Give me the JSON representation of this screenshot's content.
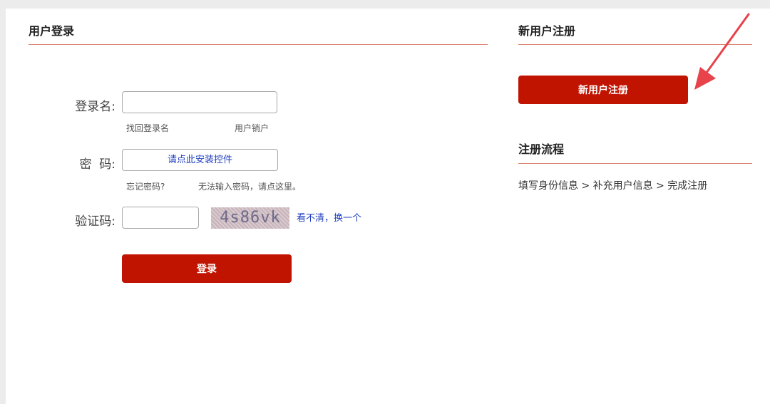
{
  "login": {
    "title": "用户登录",
    "username_label": "登录名:",
    "forgot_username": "找回登录名",
    "deregister": "用户销户",
    "password_label": "密  码:",
    "password_control": "请点此安装控件",
    "forgot_password": "忘记密码?",
    "cannot_input_password": "无法输入密码，请点这里。",
    "captcha_label": "验证码:",
    "captcha_text": "4s86vk",
    "captcha_refresh": "看不清，换一个",
    "login_button": "登录",
    "username_value": "",
    "captcha_value": ""
  },
  "register": {
    "title": "新用户注册",
    "button": "新用户注册"
  },
  "flow": {
    "title": "注册流程",
    "steps": "填写身份信息 > 补充用户信息 > 完成注册"
  },
  "colors": {
    "accent": "#c01300",
    "rule": "#d9826f",
    "link": "#1f3fbf",
    "annotation_arrow": "#e8424a"
  },
  "icons": {
    "annotation": "red-pointer-arrow"
  }
}
